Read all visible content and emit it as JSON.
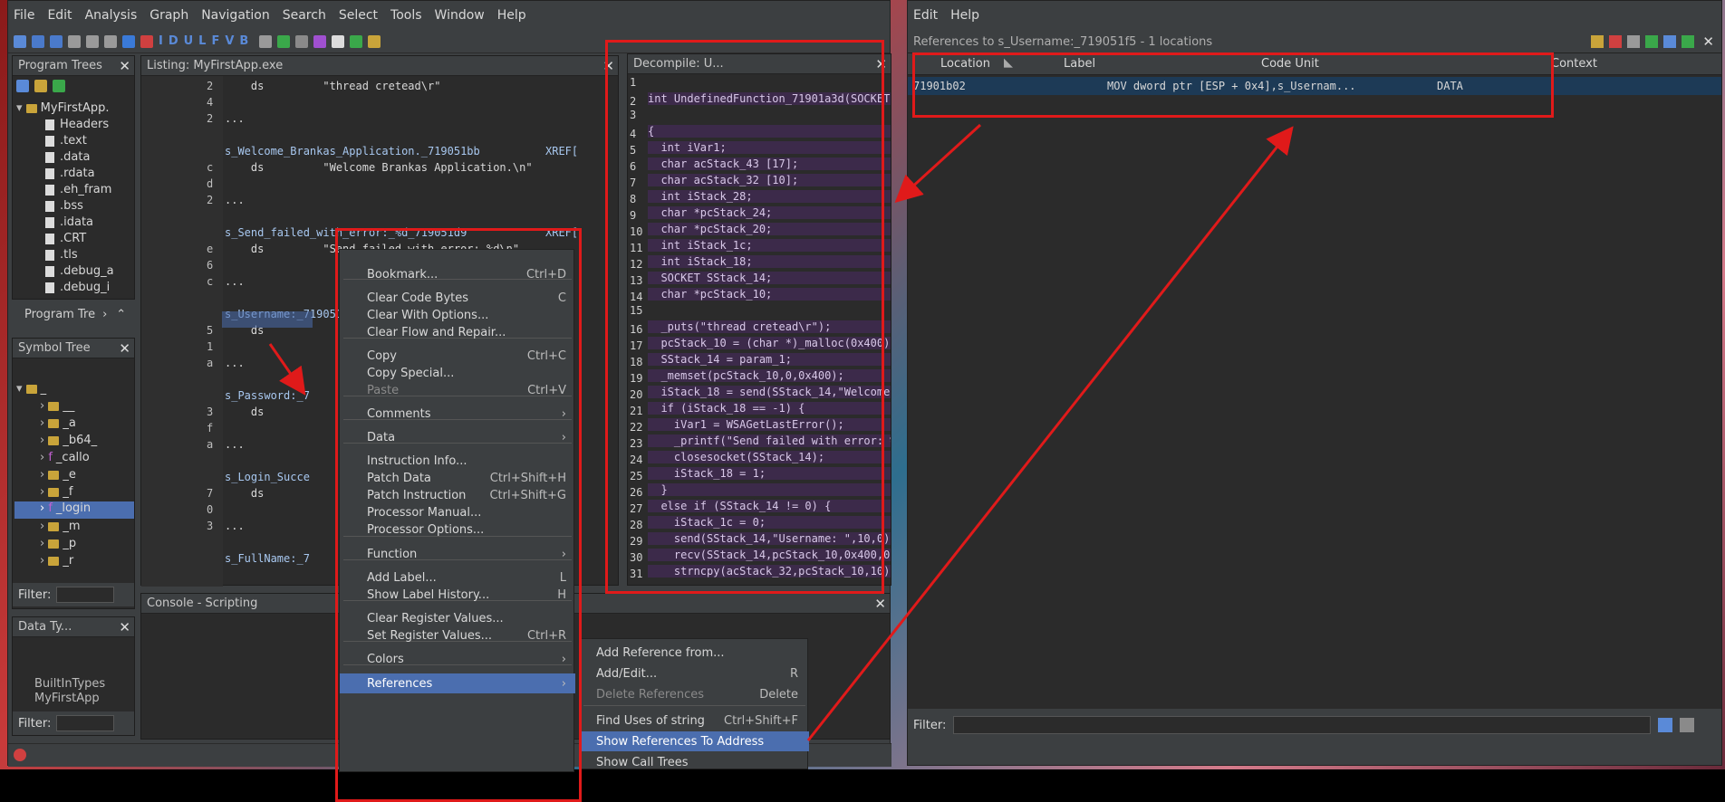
{
  "main_menu": [
    "File",
    "Edit",
    "Analysis",
    "Graph",
    "Navigation",
    "Search",
    "Select",
    "Tools",
    "Window",
    "Help"
  ],
  "program_trees": {
    "title": "Program Trees",
    "root": "MyFirstApp.",
    "items": [
      "Headers",
      ".text",
      ".data",
      ".rdata",
      ".eh_fram",
      ".bss",
      ".idata",
      ".CRT",
      ".tls",
      ".debug_a",
      ".debug_i"
    ],
    "tab_label": "Program Tre"
  },
  "symbol_tree": {
    "title": "Symbol Tree",
    "items": [
      "_",
      "__",
      "_a",
      "_b64_",
      "_callo",
      "_e",
      "_f",
      "_login",
      "_m",
      "_p",
      "_r"
    ],
    "filter_label": "Filter:"
  },
  "data_types": {
    "title": "Data Ty...",
    "items": [
      "BuiltInTypes",
      "MyFirstApp"
    ],
    "filter_label": "Filter:"
  },
  "listing": {
    "title": "Listing:  MyFirstApp.exe",
    "lines": [
      {
        "addr": "2",
        "text": "    ds         \"thread cretead\\r\""
      },
      {
        "addr": "4",
        "text": ""
      },
      {
        "addr": "2",
        "text": "..."
      },
      {
        "addr": "",
        "text": ""
      },
      {
        "addr": "",
        "text": "s_Welcome_Brankas_Application._719051bb          XREF["
      },
      {
        "addr": "c",
        "text": "    ds         \"Welcome Brankas Application.\\n\""
      },
      {
        "addr": "d",
        "text": ""
      },
      {
        "addr": "2",
        "text": "..."
      },
      {
        "addr": "",
        "text": ""
      },
      {
        "addr": "",
        "text": "s_Send_failed_with_error:_%d_719051d9            XREF["
      },
      {
        "addr": "e",
        "text": "    ds         \"Send failed with error: %d\\n\""
      },
      {
        "addr": "6",
        "text": ""
      },
      {
        "addr": "c",
        "text": "..."
      },
      {
        "addr": "",
        "text": ""
      },
      {
        "addr": "",
        "text": "s_Username:_719051f5"
      },
      {
        "addr": "5",
        "text": "    ds"
      },
      {
        "addr": "1",
        "text": ""
      },
      {
        "addr": "a",
        "text": "..."
      },
      {
        "addr": "",
        "text": ""
      },
      {
        "addr": "",
        "text": "s_Password:_7"
      },
      {
        "addr": "3",
        "text": "    ds"
      },
      {
        "addr": "f",
        "text": ""
      },
      {
        "addr": "a",
        "text": "..."
      },
      {
        "addr": "",
        "text": ""
      },
      {
        "addr": "",
        "text": "s_Login_Succe"
      },
      {
        "addr": "7",
        "text": "    ds"
      },
      {
        "addr": "0",
        "text": ""
      },
      {
        "addr": "3",
        "text": "..."
      },
      {
        "addr": "",
        "text": ""
      },
      {
        "addr": "",
        "text": "s_FullName:_7"
      }
    ]
  },
  "decompile": {
    "title": "Decompile: U...",
    "lines": [
      "",
      "int UndefinedFunction_71901a3d(SOCKET p",
      "",
      "{",
      "  int iVar1;",
      "  char acStack_43 [17];",
      "  char acStack_32 [10];",
      "  int iStack_28;",
      "  char *pcStack_24;",
      "  char *pcStack_20;",
      "  int iStack_1c;",
      "  int iStack_18;",
      "  SOCKET SStack_14;",
      "  char *pcStack_10;",
      "",
      "  _puts(\"thread cretead\\r\");",
      "  pcStack_10 = (char *)_malloc(0x400);",
      "  SStack_14 = param_1;",
      "  _memset(pcStack_10,0,0x400);",
      "  iStack_18 = send(SStack_14,\"Welcome B",
      "  if (iStack_18 == -1) {",
      "    iVar1 = WSAGetLastError();",
      "    _printf(\"Send failed with error: %d",
      "    closesocket(SStack_14);",
      "    iStack_18 = 1;",
      "  }",
      "  else if (SStack_14 != 0) {",
      "    iStack_1c = 0;",
      "    send(SStack_14,\"Username: \",10,0);",
      "    recv(SStack_14,pcStack_10,0x400,0);",
      "    strncpy(acStack_32,pcStack_10,10);"
    ]
  },
  "console": {
    "title": "Console - Scripting"
  },
  "context_menu": {
    "items": [
      {
        "label": "Bookmark...",
        "shortcut": "Ctrl+D"
      },
      {
        "label": "Clear Code Bytes",
        "shortcut": "C"
      },
      {
        "label": "Clear With Options...",
        "shortcut": ""
      },
      {
        "label": "Clear Flow and Repair...",
        "shortcut": ""
      },
      {
        "label": "Copy",
        "shortcut": "Ctrl+C"
      },
      {
        "label": "Copy Special...",
        "shortcut": ""
      },
      {
        "label": "Paste",
        "shortcut": "Ctrl+V"
      },
      {
        "label": "Comments",
        "shortcut": "›"
      },
      {
        "label": "Data",
        "shortcut": "›"
      },
      {
        "label": "Instruction Info...",
        "shortcut": ""
      },
      {
        "label": "Patch Data",
        "shortcut": "Ctrl+Shift+H"
      },
      {
        "label": "Patch Instruction",
        "shortcut": "Ctrl+Shift+G"
      },
      {
        "label": "Processor Manual...",
        "shortcut": ""
      },
      {
        "label": "Processor Options...",
        "shortcut": ""
      },
      {
        "label": "Function",
        "shortcut": "›"
      },
      {
        "label": "Add Label...",
        "shortcut": "L"
      },
      {
        "label": "Show Label History...",
        "shortcut": "H"
      },
      {
        "label": "Clear Register Values...",
        "shortcut": ""
      },
      {
        "label": "Set Register Values...",
        "shortcut": "Ctrl+R"
      },
      {
        "label": "Colors",
        "shortcut": "›"
      },
      {
        "label": "References",
        "shortcut": "›"
      }
    ]
  },
  "references_submenu": {
    "items": [
      {
        "label": "Add Reference from...",
        "shortcut": ""
      },
      {
        "label": "Add/Edit...",
        "shortcut": "R"
      },
      {
        "label": "Delete References",
        "shortcut": "Delete"
      },
      {
        "label": "Find Uses of string",
        "shortcut": "Ctrl+Shift+F"
      },
      {
        "label": "Show References To Address",
        "shortcut": ""
      },
      {
        "label": "Show Call Trees",
        "shortcut": ""
      }
    ]
  },
  "references_window": {
    "menu": [
      "Edit",
      "Help"
    ],
    "title": "References to s_Username:_719051f5 - 1 locations",
    "columns": [
      "Location",
      "Label",
      "Code Unit",
      "Context"
    ],
    "rows": [
      {
        "location": "71901b02",
        "label": "",
        "code_unit": "MOV dword ptr [ESP + 0x4],s_Usernam...",
        "context": "DATA"
      }
    ],
    "filter_label": "Filter:"
  },
  "annotation_color": "#e01a1a",
  "selection_color": "#4b6eaf"
}
